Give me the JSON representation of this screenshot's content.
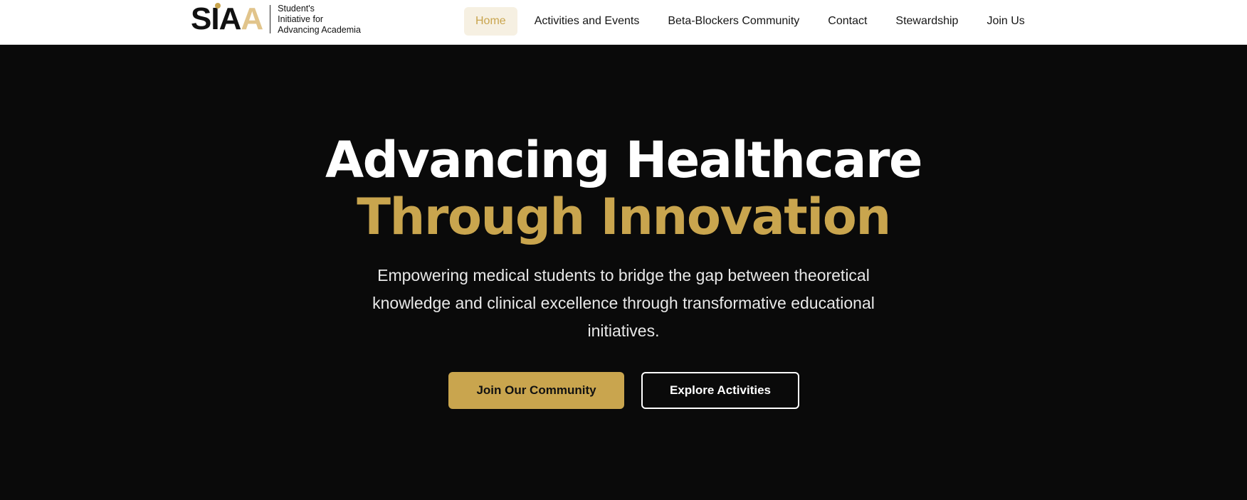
{
  "brand": {
    "mark_s": "S",
    "mark_i": "I",
    "mark_a1": "A",
    "mark_a2": "A",
    "line1": "Student's",
    "line2": "Initiative for",
    "line3": "Advancing Academia",
    "dot_color": "#c9a54e",
    "secondary_color": "#e1c48b"
  },
  "nav": {
    "items": [
      {
        "label": "Home",
        "active": true
      },
      {
        "label": "Activities and Events",
        "active": false
      },
      {
        "label": "Beta-Blockers Community",
        "active": false
      },
      {
        "label": "Contact",
        "active": false
      },
      {
        "label": "Stewardship",
        "active": false
      },
      {
        "label": "Join Us",
        "active": false
      }
    ]
  },
  "hero": {
    "title_line1": "Advancing Healthcare",
    "title_line2": "Through Innovation",
    "subtitle": "Empowering medical students to bridge the gap between theoretical knowledge and clinical excellence through transformative educational initiatives.",
    "primary_button": "Join Our Community",
    "secondary_button": "Explore Activities"
  },
  "colors": {
    "accent_gold": "#c9a54e",
    "hero_background": "#0a0a0a",
    "header_background": "#ffffff",
    "active_nav_background": "#f6f0e2"
  }
}
